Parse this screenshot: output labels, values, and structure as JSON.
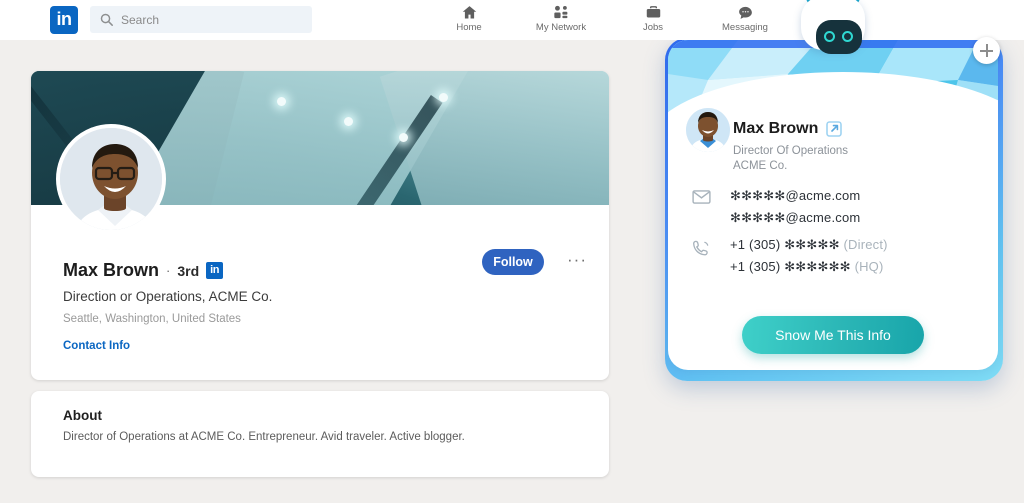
{
  "nav": {
    "logo_text": "in",
    "logo_icon": "linkedin-logo-icon",
    "search": {
      "icon": "search-icon",
      "placeholder": "Search",
      "value": ""
    },
    "items": [
      {
        "label": "Home",
        "icon": "home-icon"
      },
      {
        "label": "My Network",
        "icon": "people-icon"
      },
      {
        "label": "Jobs",
        "icon": "briefcase-icon"
      },
      {
        "label": "Messaging",
        "icon": "chat-bubble-icon"
      }
    ]
  },
  "profile": {
    "banner_alt": "glass-architecture-banner",
    "avatar_alt": "profile-photo",
    "name": "Max Brown",
    "separator": "·",
    "degree": "3rd",
    "in_badge": "in",
    "headline": "Direction or Operations, ACME Co.",
    "location": "Seattle, Washington, United States",
    "contact_link": "Contact Info",
    "follow_label": "Follow",
    "more_label": "···"
  },
  "about": {
    "title": "About",
    "text": "Director of Operations at ACME Co. Entrepreneur. Avid traveler. Active blogger."
  },
  "bot_card": {
    "mascot": "robot-mascot-icon",
    "plus": "plus-button-icon",
    "avatar_alt": "contact-photo",
    "name": "Max Brown",
    "external_link_icon": "external-link-icon",
    "job_title": "Director Of Operations",
    "company": "ACME Co.",
    "email": {
      "icon": "envelope-icon",
      "values": [
        "✻✻✻✻✻@acme.com",
        "✻✻✻✻✻@acme.com"
      ]
    },
    "phone": {
      "icon": "phone-icon",
      "values": [
        {
          "number": "+1 (305) ✻✻✻✻✻",
          "tag": "(Direct)"
        },
        {
          "number": "+1 (305) ✻✻✻✻✻✻",
          "tag": "(HQ)"
        }
      ]
    },
    "cta_label": "Snow Me This Info"
  },
  "colors": {
    "linkedin_blue": "#0a66c2",
    "follow_blue": "#2f63c0",
    "cta_teal": "#2bb6b6",
    "card_frame_blue": "#4b8ef7",
    "page_bg": "#f1efed"
  }
}
